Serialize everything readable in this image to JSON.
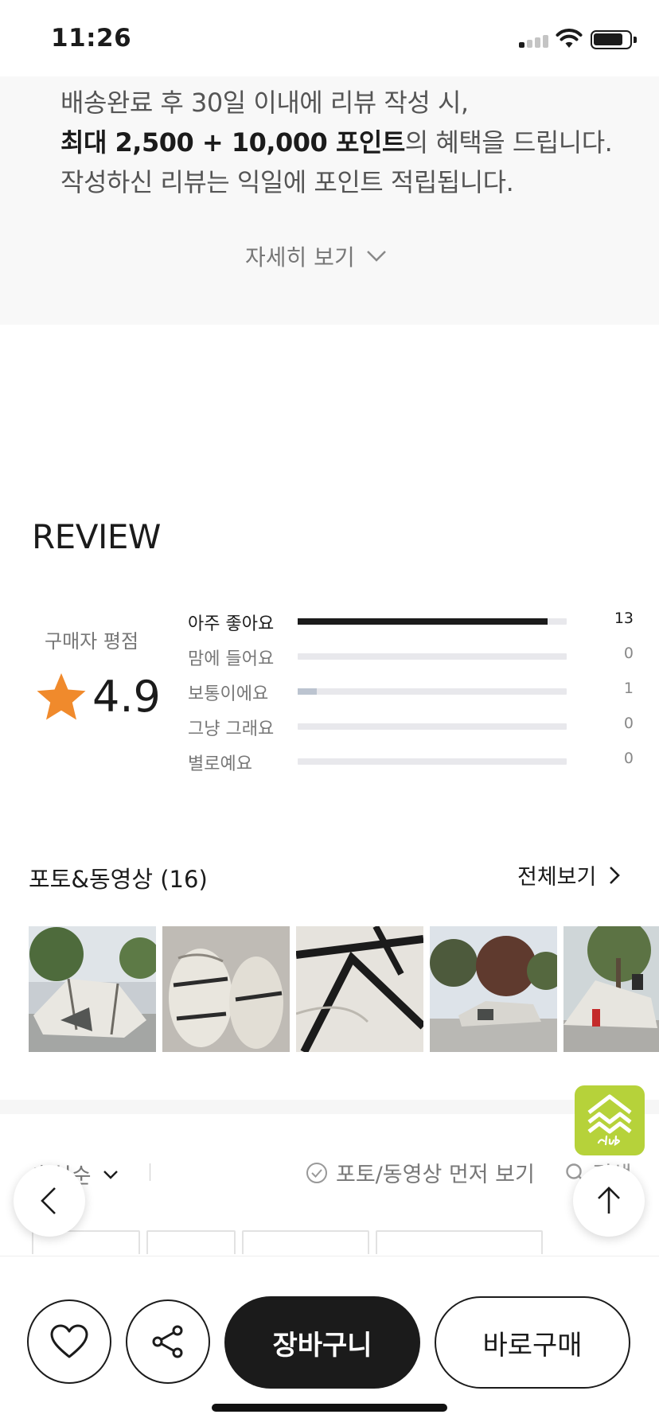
{
  "status_bar": {
    "time": "11:26"
  },
  "notice": {
    "line1": "배송완료 후 30일 이내에 리뷰 작성 시,",
    "line2_bold": "최대 2,500 + 10,000 포인트",
    "line2_rest": "의 혜택을 드립니다.",
    "line3": "작성하신 리뷰는 익일에 포인트 적립됩니다.",
    "more_label": "자세히 보기"
  },
  "review": {
    "title": "REVIEW",
    "rating_label": "구매자 평점",
    "score": "4.9",
    "distribution": [
      {
        "label": "아주 좋아요",
        "count": "13",
        "ratio": 0.93
      },
      {
        "label": "맘에 들어요",
        "count": "0",
        "ratio": 0
      },
      {
        "label": "보통이에요",
        "count": "1",
        "ratio": 0.072
      },
      {
        "label": "그냥 그래요",
        "count": "0",
        "ratio": 0
      },
      {
        "label": "별로예요",
        "count": "0",
        "ratio": 0
      }
    ]
  },
  "photos": {
    "title": "포토&동영상 (16)",
    "view_all": "전체보기"
  },
  "sort_bar": {
    "sort_label": "추천순",
    "photo_first": "포토/동영상 먼저 보기",
    "search": "검색"
  },
  "bottom_bar": {
    "cart": "장바구니",
    "buy": "바로구매"
  },
  "colors": {
    "star": "#f08a2c",
    "accent_badge": "#b6d23a",
    "dark": "#1b1b1b"
  }
}
